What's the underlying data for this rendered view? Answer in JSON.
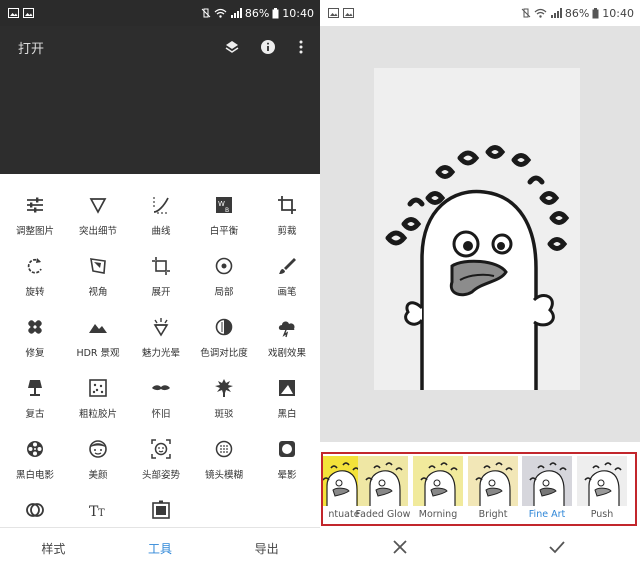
{
  "status": {
    "battery": "86%",
    "time": "10:40"
  },
  "left": {
    "header": {
      "open_label": "打开"
    },
    "tools": [
      {
        "label": "调整图片",
        "icon": "tune-icon"
      },
      {
        "label": "突出细节",
        "icon": "details-triangle-icon"
      },
      {
        "label": "曲线",
        "icon": "curves-icon"
      },
      {
        "label": "白平衡",
        "icon": "white-balance-icon"
      },
      {
        "label": "剪裁",
        "icon": "crop-icon"
      },
      {
        "label": "旋转",
        "icon": "rotate-icon"
      },
      {
        "label": "视角",
        "icon": "perspective-icon"
      },
      {
        "label": "展开",
        "icon": "expand-icon"
      },
      {
        "label": "局部",
        "icon": "selective-icon"
      },
      {
        "label": "画笔",
        "icon": "brush-icon"
      },
      {
        "label": "修复",
        "icon": "healing-icon"
      },
      {
        "label": "HDR 景观",
        "icon": "hdr-mountain-icon"
      },
      {
        "label": "魅力光晕",
        "icon": "glamour-glow-icon"
      },
      {
        "label": "色调对比度",
        "icon": "tonal-contrast-icon"
      },
      {
        "label": "戏剧效果",
        "icon": "drama-cloud-icon"
      },
      {
        "label": "复古",
        "icon": "vintage-lamp-icon"
      },
      {
        "label": "粗粒胶片",
        "icon": "grainy-film-icon"
      },
      {
        "label": "怀旧",
        "icon": "mustache-icon"
      },
      {
        "label": "斑驳",
        "icon": "grunge-icon"
      },
      {
        "label": "黑白",
        "icon": "black-white-icon"
      },
      {
        "label": "黑白电影",
        "icon": "film-reel-icon"
      },
      {
        "label": "美颜",
        "icon": "face-icon"
      },
      {
        "label": "头部姿势",
        "icon": "head-pose-icon"
      },
      {
        "label": "镜头模糊",
        "icon": "lens-blur-icon"
      },
      {
        "label": "晕影",
        "icon": "vignette-icon"
      },
      {
        "label": "",
        "icon": "double-exposure-icon"
      },
      {
        "label": "",
        "icon": "text-icon"
      },
      {
        "label": "",
        "icon": "frame-icon"
      }
    ],
    "bottom_nav": [
      {
        "label": "样式",
        "active": false
      },
      {
        "label": "工具",
        "active": true
      },
      {
        "label": "导出",
        "active": false
      }
    ]
  },
  "right": {
    "filters": [
      {
        "label": "ntuate",
        "tint": "#f3e23a",
        "active": false
      },
      {
        "label": "Faded Glow",
        "tint": "#efe7a4",
        "active": false
      },
      {
        "label": "Morning",
        "tint": "#f1ea9c",
        "active": false
      },
      {
        "label": "Bright",
        "tint": "#f2e7b7",
        "active": false
      },
      {
        "label": "Fine Art",
        "tint": "#d6d6dc",
        "active": true
      },
      {
        "label": "Push",
        "tint": "#eeeeee",
        "active": false
      }
    ]
  },
  "colors": {
    "accent": "#2f87d8",
    "highlight_border": "#c2262c"
  }
}
